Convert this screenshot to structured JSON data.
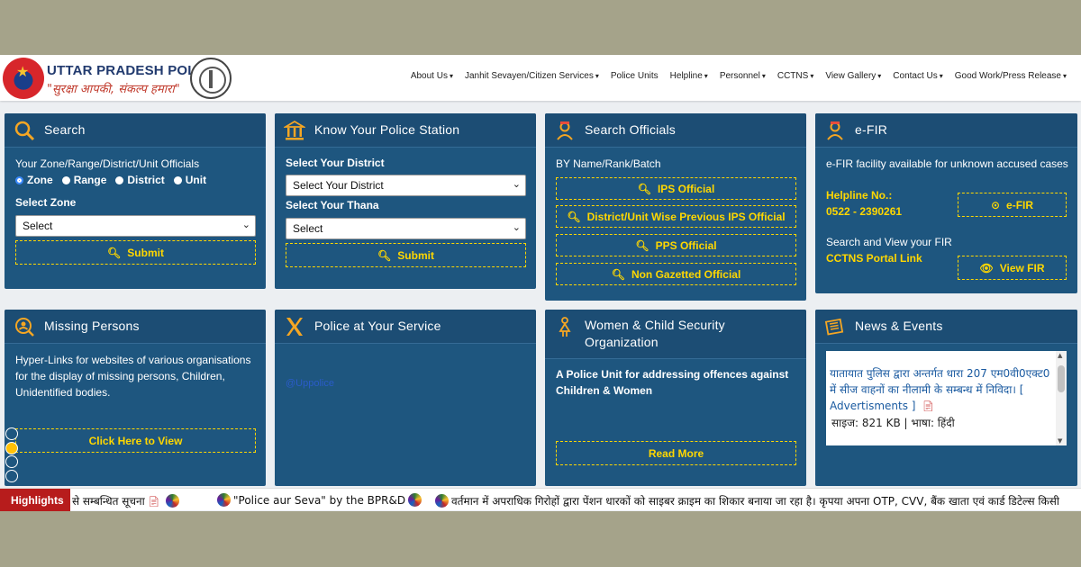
{
  "header": {
    "title": "UTTAR PRADESH POLICE",
    "tagline": "\"सुरक्षा आपकी, संकल्प हमारा\"",
    "nav": [
      {
        "label": "About Us",
        "dropdown": true
      },
      {
        "label": "Janhit Sevayen/Citizen Services",
        "dropdown": true
      },
      {
        "label": "Police Units",
        "dropdown": false
      },
      {
        "label": "Helpline",
        "dropdown": true
      },
      {
        "label": "Personnel",
        "dropdown": true
      },
      {
        "label": "CCTNS",
        "dropdown": true
      },
      {
        "label": "View Gallery",
        "dropdown": true
      },
      {
        "label": "Contact Us",
        "dropdown": true
      },
      {
        "label": "Good Work/Press Release",
        "dropdown": true
      }
    ]
  },
  "search": {
    "title": "Search",
    "subtitle": "Your Zone/Range/District/Unit Officials",
    "radios": [
      "Zone",
      "Range",
      "District",
      "Unit"
    ],
    "selected_radio": "Zone",
    "zone_label": "Select Zone",
    "zone_value": "Select",
    "submit": "Submit"
  },
  "police_station": {
    "title": "Know Your Police Station",
    "district_label": "Select Your District",
    "district_value": "Select Your District",
    "thana_label": "Select Your Thana",
    "thana_value": "Select",
    "submit": "Submit"
  },
  "officials": {
    "title": "Search Officials",
    "subtitle": "BY Name/Rank/Batch",
    "buttons": [
      "IPS Official",
      "District/Unit Wise Previous IPS Official",
      "PPS Official",
      "Non Gazetted Official"
    ]
  },
  "efir": {
    "title": "e-FIR",
    "desc": "e-FIR facility available for unknown accused cases",
    "helpline_label": "Helpline No.:",
    "helpline_number": "0522 - 2390261",
    "efir_button": "e-FIR",
    "view_desc": "Search and View your FIR",
    "cctns_link": "CCTNS Portal Link",
    "view_button": "View FIR"
  },
  "missing": {
    "title": "Missing Persons",
    "desc": "Hyper-Links for websites of various organisations for the display of missing persons, Children, Unidentified bodies.",
    "button": "Click Here to View"
  },
  "service": {
    "title": "Police at Your Service",
    "handle": "@Uppolice"
  },
  "women": {
    "title_line1": "Women & Child Security",
    "title_line2": "Organization",
    "desc": "A Police Unit for addressing offences against Children & Women",
    "button": "Read More"
  },
  "news": {
    "title": "News & Events",
    "item_text": "यातायात पुलिस द्वारा अन्तर्गत धारा 207 एम0वी0एक्ट0 में सीज वाहनों का नीलामी के सम्बन्ध में निविदा। [ Advertisments ]",
    "item_meta": "साइज: 821 KB | भाषा: हिंदी"
  },
  "ticker": {
    "label": "Highlights",
    "items": [
      "से सम्बन्धित सूचना",
      "\"Police aur Seva\" by the BPR&D",
      "वर्तमान में अपराधिक गिरोहों द्वारा पेंशन धारकों को साइबर क्राइम का शिकार बनाया जा रहा है। कृपया अपना OTP, CVV, बैंक खाता एवं कार्ड डिटेल्स किसी"
    ]
  },
  "colors": {
    "card_bg": "#1e567f",
    "accent_yellow": "#ffd700",
    "highlight_red": "#b71c1c"
  }
}
